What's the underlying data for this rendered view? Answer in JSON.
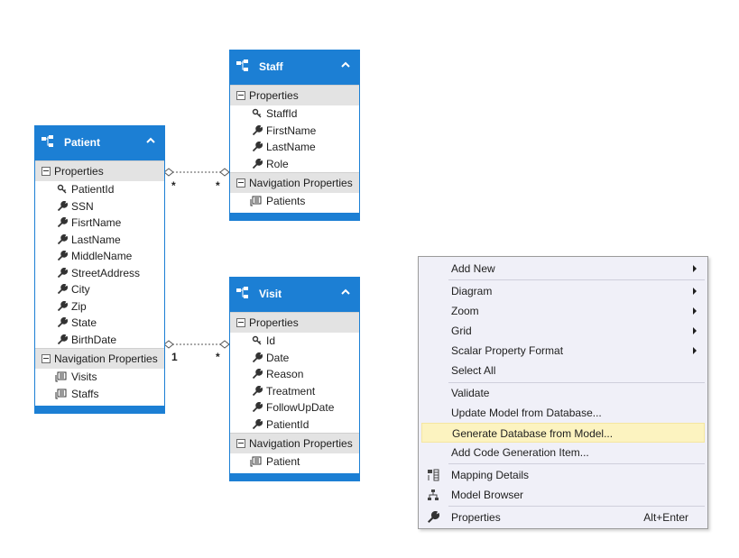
{
  "colors": {
    "entity_blue": "#1c7fd4",
    "section_gray": "#e3e3e3",
    "menu_bg": "#f0f0f8",
    "menu_highlight": "#fcf3c0"
  },
  "entities": {
    "staff": {
      "title": "Staff",
      "properties_label": "Properties",
      "properties": [
        "StaffId",
        "FirstName",
        "LastName",
        "Role"
      ],
      "navigation_label": "Navigation Properties",
      "navigation": [
        "Patients"
      ]
    },
    "patient": {
      "title": "Patient",
      "properties_label": "Properties",
      "properties": [
        "PatientId",
        "SSN",
        "FisrtName",
        "LastName",
        "MiddleName",
        "StreetAddress",
        "City",
        "Zip",
        "State",
        "BirthDate"
      ],
      "navigation_label": "Navigation Properties",
      "navigation": [
        "Visits",
        "Staffs"
      ]
    },
    "visit": {
      "title": "Visit",
      "properties_label": "Properties",
      "properties": [
        "Id",
        "Date",
        "Reason",
        "Treatment",
        "FollowUpDate",
        "PatientId"
      ],
      "navigation_label": "Navigation Properties",
      "navigation": [
        "Patient"
      ]
    }
  },
  "associations": {
    "patient_staff": {
      "left": "*",
      "right": "*"
    },
    "patient_visit": {
      "left": "1",
      "right": "*"
    }
  },
  "context_menu": {
    "items": {
      "add_new": "Add New",
      "diagram": "Diagram",
      "zoom": "Zoom",
      "grid": "Grid",
      "scalar_property_format": "Scalar Property Format",
      "select_all": "Select All",
      "validate": "Validate",
      "update_model": "Update Model from Database...",
      "generate_database": "Generate Database from Model...",
      "add_code_generation": "Add Code Generation Item...",
      "mapping_details": "Mapping Details",
      "model_browser": "Model Browser",
      "properties": "Properties"
    },
    "shortcuts": {
      "properties": "Alt+Enter"
    }
  }
}
